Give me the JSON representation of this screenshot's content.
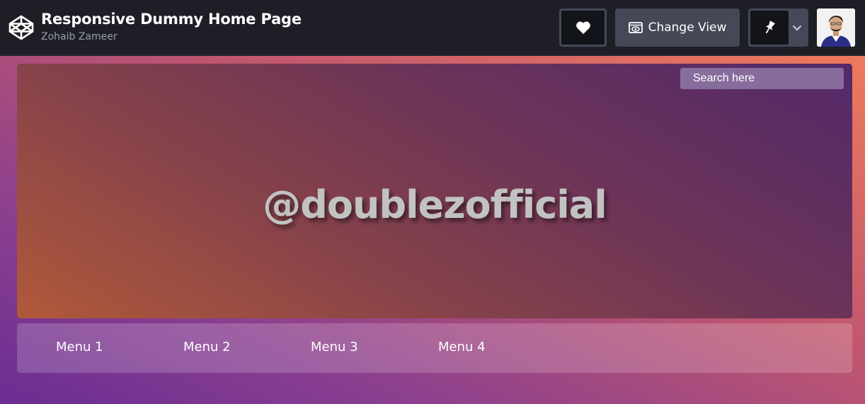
{
  "header": {
    "title": "Responsive Dummy Home Page",
    "author": "Zohaib Zameer",
    "logo_icon": "codepen-cube-icon",
    "change_view_label": "Change View",
    "heart_icon": "heart-icon",
    "view_icon": "eye-window-icon",
    "pin_icon": "pin-icon",
    "chevron_icon": "chevron-down-icon"
  },
  "preview": {
    "search_placeholder": "Search here",
    "hero_text": "@doublezofficial",
    "menu": [
      {
        "label": "Menu 1"
      },
      {
        "label": "Menu 2"
      },
      {
        "label": "Menu 3"
      },
      {
        "label": "Menu 4"
      }
    ]
  },
  "colors": {
    "topbar_bg": "#1e1f26",
    "button_bg": "#444857",
    "button_dark": "#131419",
    "gradient_purple": "#6a2d93",
    "gradient_orange": "#ee7a5c"
  }
}
